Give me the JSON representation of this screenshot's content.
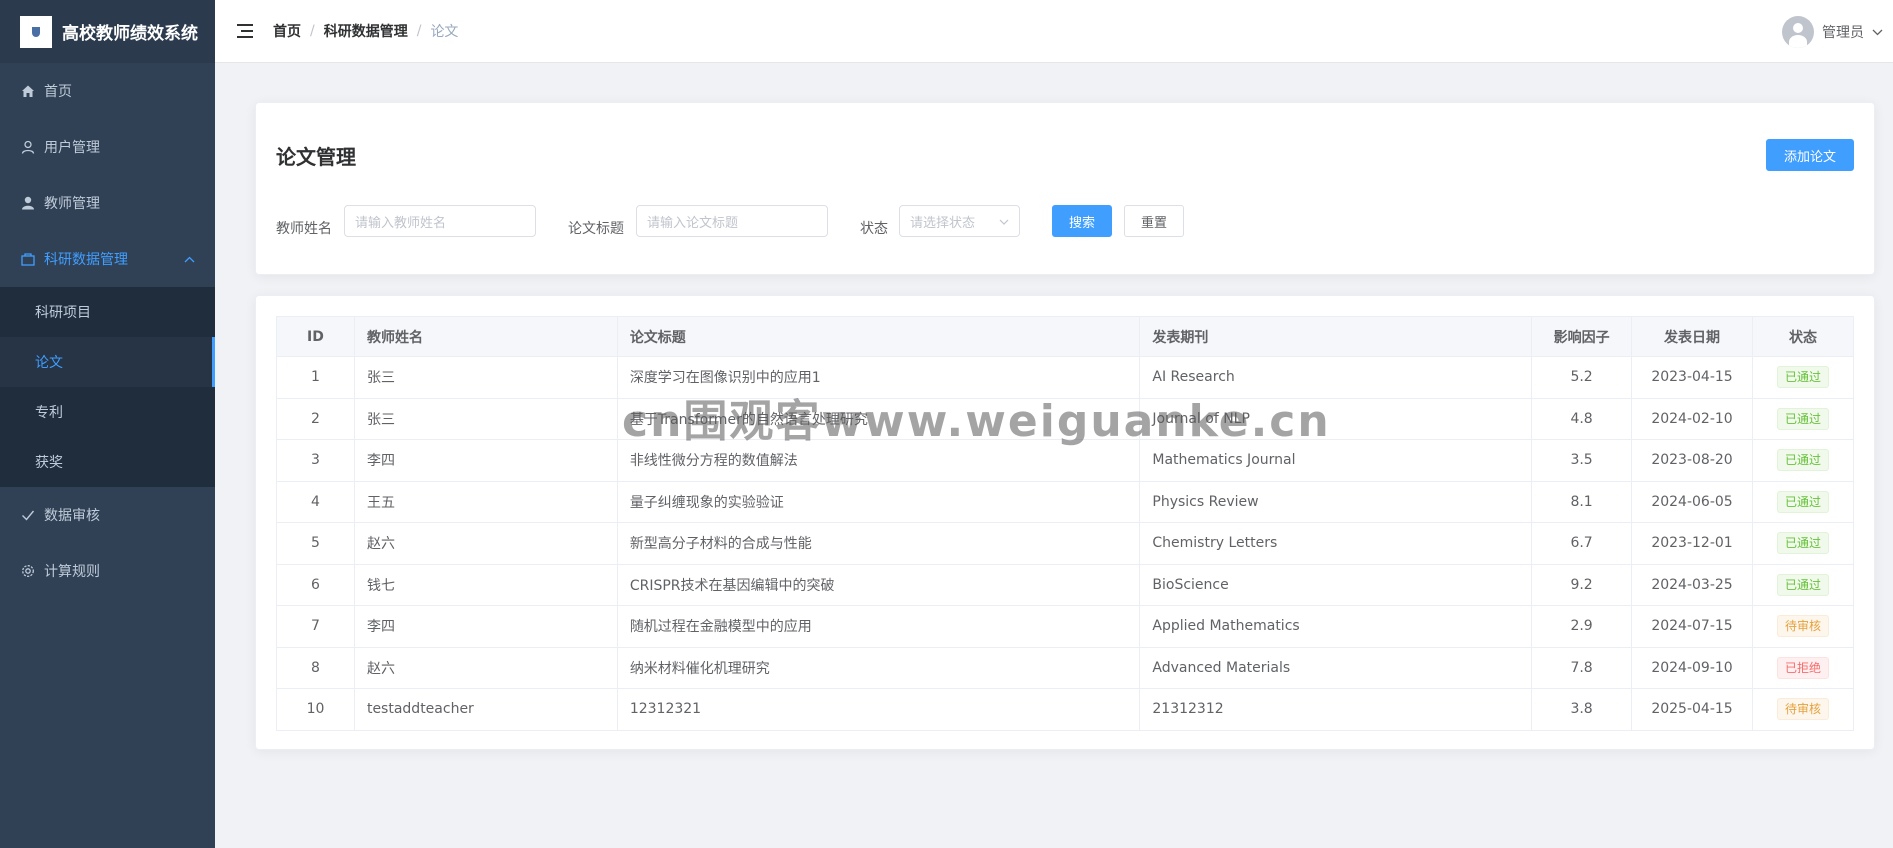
{
  "app": {
    "title": "高校教师绩效系统"
  },
  "sidebar": {
    "items": [
      {
        "label": "首页",
        "icon": "home-icon"
      },
      {
        "label": "用户管理",
        "icon": "user-icon"
      },
      {
        "label": "教师管理",
        "icon": "teacher-icon"
      },
      {
        "label": "科研数据管理",
        "icon": "folder-icon",
        "expanded": true
      },
      {
        "label": "数据审核",
        "icon": "check-icon"
      },
      {
        "label": "计算规则",
        "icon": "gear-icon"
      }
    ],
    "sub_items": [
      {
        "label": "科研项目"
      },
      {
        "label": "论文",
        "active": true
      },
      {
        "label": "专利"
      },
      {
        "label": "获奖"
      }
    ]
  },
  "header": {
    "breadcrumb": [
      "首页",
      "科研数据管理",
      "论文"
    ],
    "user_name": "管理员"
  },
  "search": {
    "title": "论文管理",
    "add_label": "添加论文",
    "teacher_label": "教师姓名",
    "teacher_placeholder": "请输入教师姓名",
    "paper_label": "论文标题",
    "paper_placeholder": "请输入论文标题",
    "status_label": "状态",
    "status_placeholder": "请选择状态",
    "search_label": "搜索",
    "reset_label": "重置"
  },
  "table": {
    "columns": [
      "ID",
      "教师姓名",
      "论文标题",
      "发表期刊",
      "影响因子",
      "发表日期",
      "状态"
    ],
    "rows": [
      {
        "id": "1",
        "teacher": "张三",
        "title": "深度学习在图像识别中的应用1",
        "journal": "AI Research",
        "impact": "5.2",
        "date": "2023-04-15",
        "status": "已通过"
      },
      {
        "id": "2",
        "teacher": "张三",
        "title": "基于Transformer的自然语言处理研究",
        "journal": "Journal of NLP",
        "impact": "4.8",
        "date": "2024-02-10",
        "status": "已通过"
      },
      {
        "id": "3",
        "teacher": "李四",
        "title": "非线性微分方程的数值解法",
        "journal": "Mathematics Journal",
        "impact": "3.5",
        "date": "2023-08-20",
        "status": "已通过"
      },
      {
        "id": "4",
        "teacher": "王五",
        "title": "量子纠缠现象的实验验证",
        "journal": "Physics Review",
        "impact": "8.1",
        "date": "2024-06-05",
        "status": "已通过"
      },
      {
        "id": "5",
        "teacher": "赵六",
        "title": "新型高分子材料的合成与性能",
        "journal": "Chemistry Letters",
        "impact": "6.7",
        "date": "2023-12-01",
        "status": "已通过"
      },
      {
        "id": "6",
        "teacher": "钱七",
        "title": "CRISPR技术在基因编辑中的突破",
        "journal": "BioScience",
        "impact": "9.2",
        "date": "2024-03-25",
        "status": "已通过"
      },
      {
        "id": "7",
        "teacher": "李四",
        "title": "随机过程在金融模型中的应用",
        "journal": "Applied Mathematics",
        "impact": "2.9",
        "date": "2024-07-15",
        "status": "待审核"
      },
      {
        "id": "8",
        "teacher": "赵六",
        "title": "纳米材料催化机理研究",
        "journal": "Advanced Materials",
        "impact": "7.8",
        "date": "2024-09-10",
        "status": "已拒绝"
      },
      {
        "id": "10",
        "teacher": "testaddteacher",
        "title": "12312321",
        "journal": "21312312",
        "impact": "3.8",
        "date": "2025-04-15",
        "status": "待审核"
      }
    ]
  },
  "watermark": "cn围观客www.weiguanke.cn",
  "colors": {
    "primary": "#409eff",
    "sidebar": "#304156",
    "success": "#67c23a",
    "warning": "#e6a23c",
    "danger": "#f56c6c"
  }
}
